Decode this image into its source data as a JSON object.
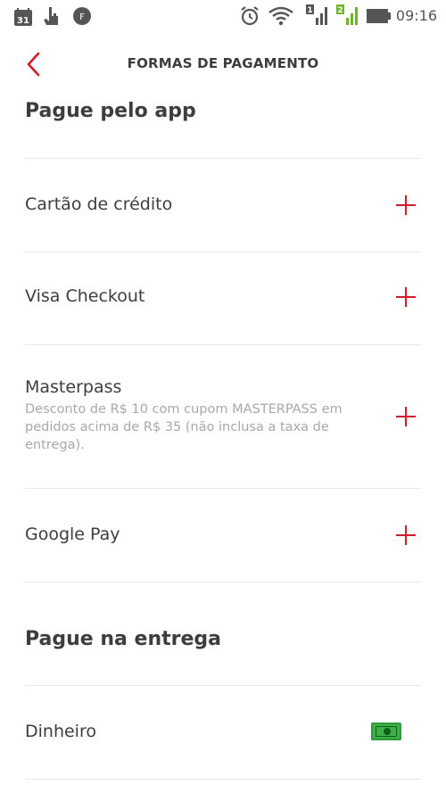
{
  "status_bar": {
    "time": "09:16",
    "calendar_day": "31",
    "sim1": "1",
    "sim2": "2"
  },
  "header": {
    "title": "FORMAS DE PAGAMENTO"
  },
  "sections": {
    "app": {
      "title": "Pague pelo app",
      "items": [
        {
          "label": "Cartão de crédito"
        },
        {
          "label": "Visa Checkout"
        },
        {
          "label": "Masterpass",
          "description": "Desconto de R$ 10 com cupom MASTERPASS em pedidos acima de R$ 35 (não inclusa a taxa de entrega)."
        },
        {
          "label": "Google Pay"
        }
      ]
    },
    "delivery": {
      "title": "Pague na entrega",
      "items": [
        {
          "label": "Dinheiro"
        }
      ]
    }
  },
  "colors": {
    "accent": "#d11a2a",
    "text": "#3d3d3d",
    "muted": "#a8a8a8",
    "divider": "#e8e8e8",
    "cash": "#3db04a"
  }
}
